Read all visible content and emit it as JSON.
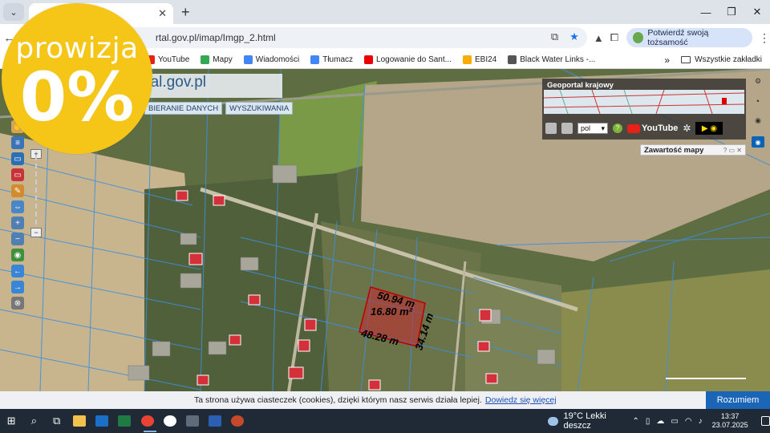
{
  "browser": {
    "tab_title": "",
    "new_tab": "+",
    "url": "rtal.gov.pl/imap/Imgp_2.html",
    "identity_label": "Potwierdź swoją tożsamość",
    "bookmarks": [
      {
        "label": "YouTube",
        "color": "#e62117"
      },
      {
        "label": "Mapy",
        "color": "#34a853"
      },
      {
        "label": "Wiadomości",
        "color": "#4285f4"
      },
      {
        "label": "Tłumacz",
        "color": "#4285f4"
      },
      {
        "label": "Logowanie do Sant...",
        "color": "#ec0000"
      },
      {
        "label": "EBI24",
        "color": "#f9ab00"
      },
      {
        "label": "Black Water Links -...",
        "color": "#555555"
      }
    ],
    "bookmarks_more": "»",
    "all_bookmarks": "Wszystkie zakładki"
  },
  "geoportal": {
    "logo_text": "rtal",
    "logo_domain": ".gov.pl",
    "menu": [
      "BIERANIE DANYCH",
      "WYSZUKIWANIA"
    ],
    "overview_title": "Geoportal krajowy",
    "language": "pol",
    "youtube_label": "YouTube",
    "content_panel_title": "Zawartość mapy",
    "content_panel_controls": "? ▭ ✕"
  },
  "measurements": {
    "area_top": "50.94 m",
    "area_mid": "16.80 m²",
    "side_bottom": "48.28 m",
    "side_right": "34.14 m"
  },
  "badge": {
    "word": "prowizja",
    "value": "0%",
    "color": "#f5c518"
  },
  "cookie_bar": {
    "text": "Ta strona używa ciasteczek (cookies), dzięki którym nasz serwis działa lepiej.",
    "link": "Dowiedz się więcej",
    "accept": "Rozumiem"
  },
  "taskbar": {
    "weather": "19°C  Lekki deszcz",
    "time": "13:37",
    "date": "23.07.2025"
  }
}
